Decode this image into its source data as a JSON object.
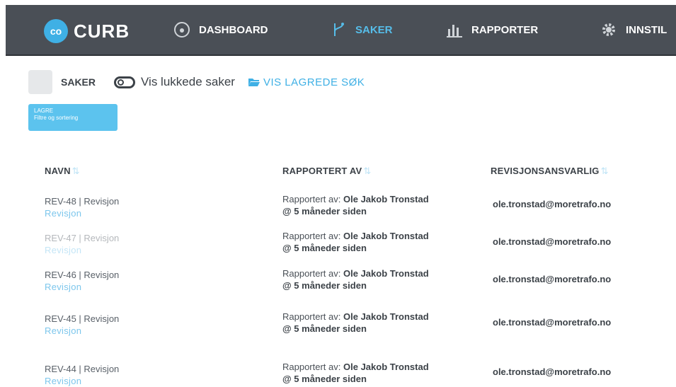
{
  "app": {
    "logo_mark": "co",
    "logo_text": "CURB"
  },
  "nav": [
    {
      "label": "DASHBOARD",
      "icon": "dashboard-icon"
    },
    {
      "label": "SAKER",
      "icon": "branch-icon",
      "active": true
    },
    {
      "label": "RAPPORTER",
      "icon": "bar-chart-icon"
    },
    {
      "label": "INNSTIL",
      "icon": "gear-icon"
    }
  ],
  "toolbar": {
    "section_label": "SAKER",
    "toggle_label": "Vis lukkede saker",
    "saved_search_label": "VIS LAGREDE SØK"
  },
  "save_button": {
    "line1": "LAGRE",
    "line2": "Filtre og sortering"
  },
  "table": {
    "columns": [
      "NAVN",
      "RAPPORTERT AV",
      "REVISJONSANSVARLIG"
    ],
    "rows": [
      {
        "id": "REV-48",
        "title": "Revisjon",
        "type": "Revisjon",
        "reporter_prefix": "Rapportert av:",
        "reporter": "Ole Jakob Tronstad",
        "when": "@ 5 måneder siden",
        "responsible": "ole.tronstad@moretrafo.no"
      },
      {
        "id": "REV-47",
        "title": "Revisjon",
        "type": "Revisjon",
        "reporter_prefix": "Rapportert av:",
        "reporter": "Ole Jakob Tronstad",
        "when": "@ 5 måneder siden",
        "responsible": "ole.tronstad@moretrafo.no"
      },
      {
        "id": "REV-46",
        "title": "Revisjon",
        "type": "Revisjon",
        "reporter_prefix": "Rapportert av:",
        "reporter": "Ole Jakob Tronstad",
        "when": "@ 5 måneder siden",
        "responsible": "ole.tronstad@moretrafo.no"
      },
      {
        "id": "REV-45",
        "title": "Revisjon",
        "type": "Revisjon",
        "reporter_prefix": "Rapportert av:",
        "reporter": "Ole Jakob Tronstad",
        "when": "@ 5 måneder siden",
        "responsible": "ole.tronstad@moretrafo.no"
      },
      {
        "id": "REV-44",
        "title": "Revisjon",
        "type": "Revisjon",
        "reporter_prefix": "Rapportert av:",
        "reporter": "Ole Jakob Tronstad",
        "when": "@ 5 måneder siden",
        "responsible": "ole.tronstad@moretrafo.no"
      }
    ]
  },
  "colors": {
    "topbar": "#4a4f56",
    "accent": "#3fb0e5"
  }
}
